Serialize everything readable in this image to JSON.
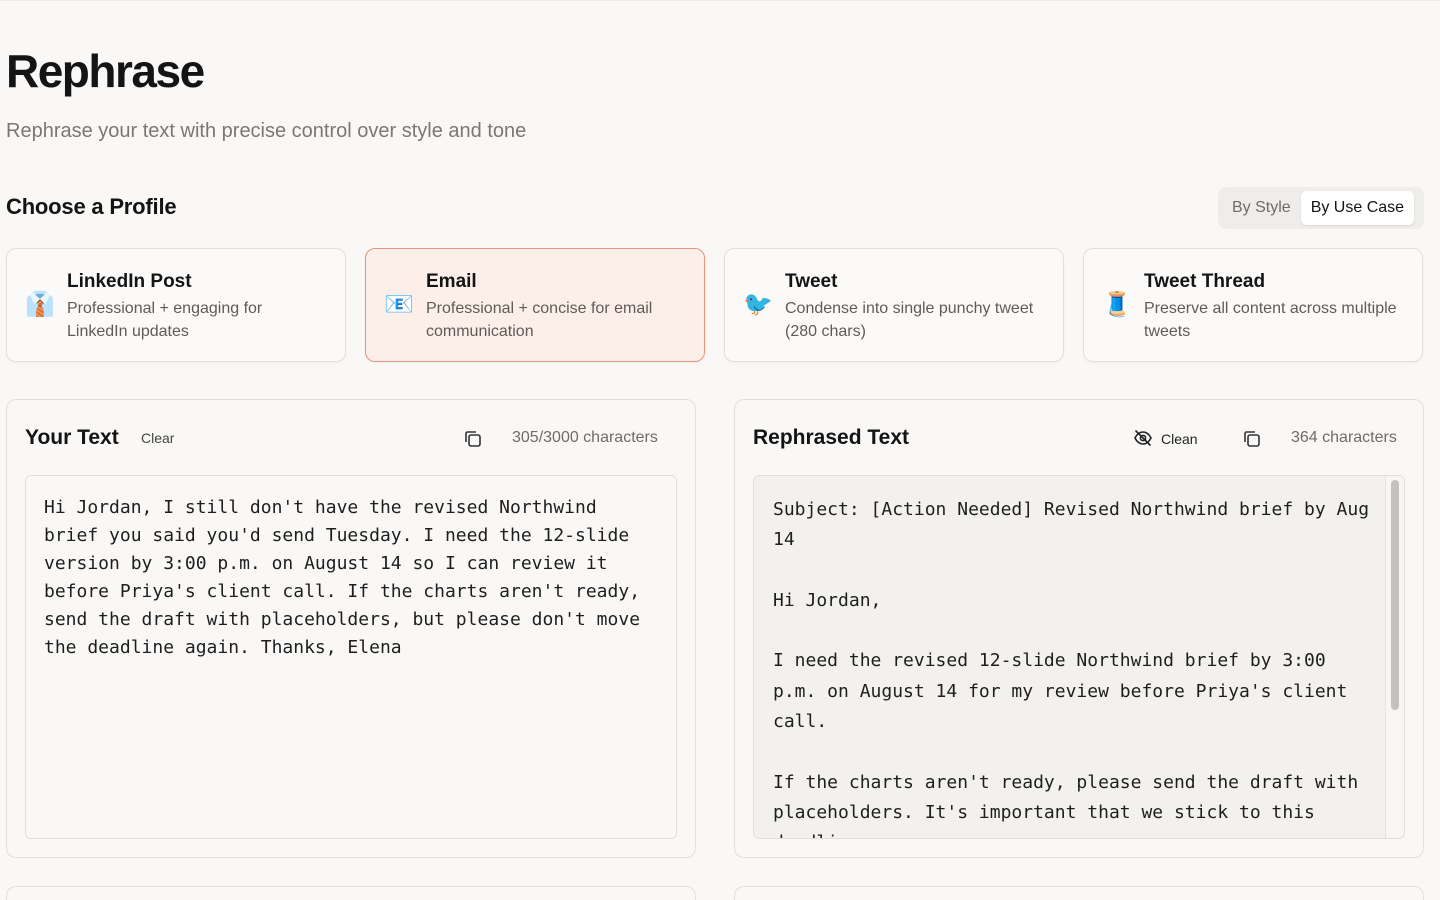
{
  "header": {
    "title": "Rephrase",
    "subtitle": "Rephrase your text with precise control over style and tone"
  },
  "profiles": {
    "section_title": "Choose a Profile",
    "toggle": {
      "options": [
        "By Style",
        "By Use Case"
      ],
      "selected": "By Use Case"
    },
    "cards": [
      {
        "icon": "👔",
        "icon_name": "necktie-icon",
        "title": "LinkedIn Post",
        "description": "Professional + engaging for LinkedIn updates",
        "selected": false
      },
      {
        "icon": "📧",
        "icon_name": "envelope-icon",
        "title": "Email",
        "description": "Professional + concise for email communication",
        "selected": true
      },
      {
        "icon": "🐦",
        "icon_name": "bird-icon",
        "title": "Tweet",
        "description": "Condense into single punchy tweet (280 chars)",
        "selected": false
      },
      {
        "icon": "🧵",
        "icon_name": "thread-spool-icon",
        "title": "Tweet Thread",
        "description": "Preserve all content across multiple tweets",
        "selected": false
      }
    ]
  },
  "input_panel": {
    "title": "Your Text",
    "clear_label": "Clear",
    "char_count": "305/3000 characters",
    "text": "Hi Jordan, I still don't have the revised Northwind brief you said you'd send Tuesday. I need the 12-slide version by 3:00 p.m. on August 14 so I can review it before Priya's client call. If the charts aren't ready, send the draft with placeholders, but please don't move the deadline again. Thanks, Elena"
  },
  "output_panel": {
    "title": "Rephrased Text",
    "clean_label": "Clean",
    "char_count": "364 characters",
    "text": "Subject: [Action Needed] Revised Northwind brief by Aug 14\n\nHi Jordan,\n\nI need the revised 12-slide Northwind brief by 3:00 p.m. on August 14 for my review before Priya's client call.\n\nIf the charts aren't ready, please send the draft with placeholders. It's important that we stick to this deadline."
  },
  "colors": {
    "background": "#f9f8f6",
    "selected_card_bg": "#fcefe9",
    "selected_card_border": "#e8957a"
  }
}
